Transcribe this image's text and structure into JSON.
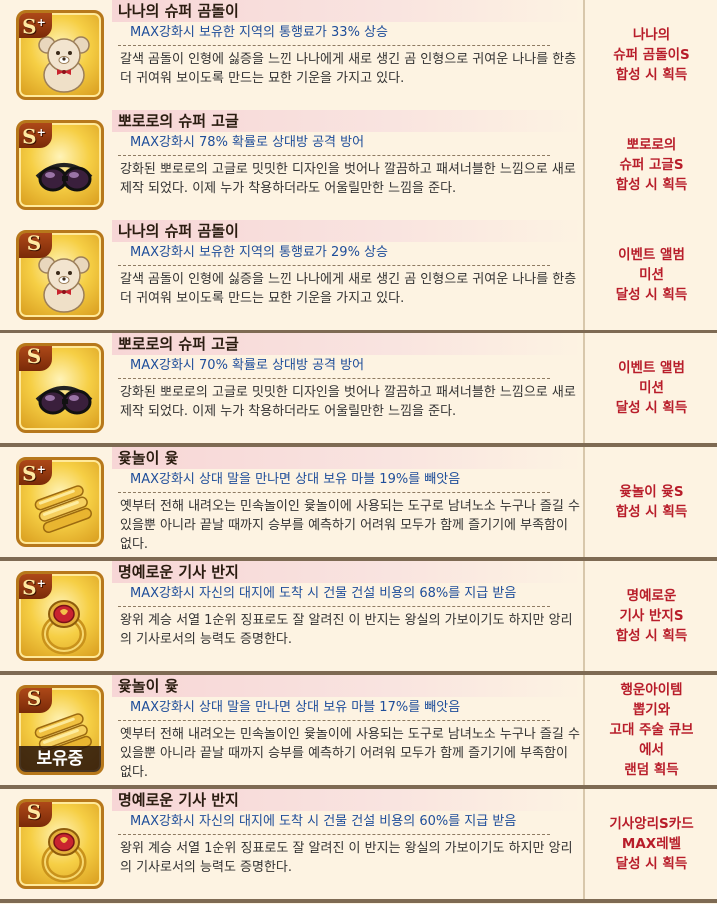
{
  "items": [
    {
      "grade": "S",
      "plus": true,
      "owned": false,
      "icon": "teddy-bear",
      "title": "나나의 슈퍼 곰돌이",
      "effect": "MAX강화시  보유한 지역의 통행료가 33% 상승",
      "description": "갈색 곰돌이 인형에 싫증을 느낀 나나에게 새로 생긴 곰 인형으로 귀여운 나나를 한층 더 귀여워 보이도록 만드는 묘한 기운을 가지고 있다.",
      "acquire": "나나의\n슈퍼 곰돌이S\n합성 시 획득"
    },
    {
      "grade": "S",
      "plus": true,
      "owned": false,
      "icon": "goggles",
      "title": "뽀로로의 슈퍼 고글",
      "effect": "MAX강화시  78% 확률로 상대방 공격 방어",
      "description": "강화된 뽀로로의 고글로 밋밋한 디자인을 벗어나 깔끔하고 패셔너블한 느낌으로 새로 제작 되었다. 이제 누가 착용하더라도 어울릴만한 느낌을 준다.",
      "acquire": "뽀로로의\n슈퍼 고글S\n합성 시 획득"
    },
    {
      "grade": "S",
      "plus": false,
      "owned": false,
      "icon": "teddy-bear",
      "title": "나나의 슈퍼 곰돌이",
      "effect": "MAX강화시  보유한 지역의 통행료가 29% 상승",
      "description": "갈색 곰돌이 인형에 싫증을 느낀 나나에게 새로 생긴 곰 인형으로 귀여운 나나를 한층 더 귀여워 보이도록 만드는 묘한 기운을 가지고 있다.",
      "acquire": "이벤트 앨범\n미션\n달성 시 획득"
    },
    {
      "grade": "S",
      "plus": false,
      "owned": false,
      "icon": "goggles",
      "title": "뽀로로의 슈퍼 고글",
      "effect": "MAX강화시  70% 확률로 상대방 공격 방어",
      "description": "강화된 뽀로로의 고글로 밋밋한 디자인을 벗어나 깔끔하고 패셔너블한 느낌으로 새로 제작 되었다. 이제 누가 착용하더라도 어울릴만한 느낌을 준다.",
      "acquire": "이벤트 앨범\n미션\n달성 시 획득"
    },
    {
      "grade": "S",
      "plus": true,
      "owned": false,
      "icon": "yut-sticks",
      "title": "윷놀이 윷",
      "effect": "MAX강화시  상대 말을 만나면 상대 보유 마블 19%를 빼앗음",
      "description": "옛부터 전해 내려오는 민속놀이인 윷놀이에 사용되는 도구로 남녀노소 누구나 즐길 수 있을뿐 아니라 끝날 때까지 승부를 예측하기 어려워 모두가 함께 즐기기에 부족함이 없다.",
      "acquire": "윷놀이 윷S\n합성 시 획득"
    },
    {
      "grade": "S",
      "plus": true,
      "owned": false,
      "icon": "ring",
      "title": "명예로운 기사 반지",
      "effect": "MAX강화시  자신의 대지에 도착 시 건물 건설 비용의 68%를 지급 받음",
      "description": "왕위 계승 서열 1순위 징표로도 잘 알려진 이 반지는 왕실의 가보이기도 하지만 앙리의 기사로서의 능력도 증명한다.",
      "acquire": "명예로운\n기사 반지S\n합성 시 획득"
    },
    {
      "grade": "S",
      "plus": false,
      "owned": true,
      "owned_label": "보유중",
      "icon": "yut-sticks",
      "title": "윷놀이 윷",
      "effect": "MAX강화시  상대 말을 만나면 상대 보유 마블 17%를 빼앗음",
      "description": "옛부터 전해 내려오는 민속놀이인 윷놀이에 사용되는 도구로 남녀노소 누구나 즐길 수 있을뿐 아니라 끝날 때까지 승부를 예측하기 어려워 모두가 함께 즐기기에 부족함이 없다.",
      "acquire": "행운아이템\n뽑기와\n고대 주술 큐브\n에서\n랜덤 획득"
    },
    {
      "grade": "S",
      "plus": false,
      "owned": false,
      "icon": "ring",
      "title": "명예로운 기사 반지",
      "effect": "MAX강화시  자신의 대지에 도착 시 건물 건설 비용의 60%를 지급 받음",
      "description": "왕위 계승 서열 1순위 징표로도 잘 알려진 이 반지는 왕실의 가보이기도 하지만 앙리의 기사로서의 능력도 증명한다.",
      "acquire": "기사앙리S카드\nMAX레벨\n달성 시 획득"
    }
  ]
}
